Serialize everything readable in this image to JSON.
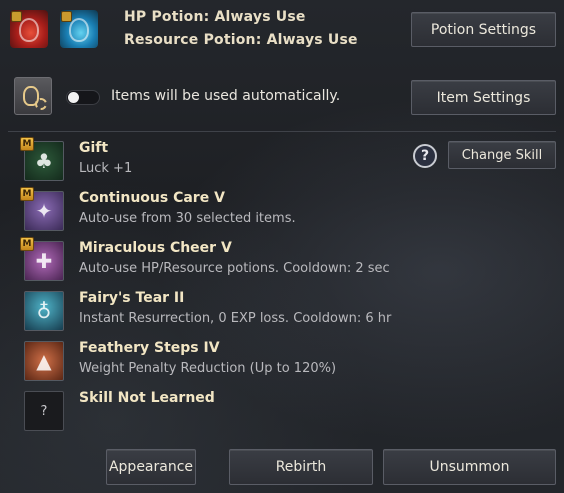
{
  "potions": {
    "hp_line": "HP Potion: Always Use",
    "resource_line": "Resource Potion: Always Use",
    "settings_button": "Potion Settings"
  },
  "auto": {
    "toggle_on": false,
    "text": "Items will be used automatically.",
    "settings_button": "Item Settings"
  },
  "skills_header": {
    "help": "?",
    "change_button": "Change Skill"
  },
  "skills": [
    {
      "badge": "M",
      "name": "Gift",
      "desc": "Luck +1",
      "icon": "clover-icon"
    },
    {
      "badge": "M",
      "name": "Continuous Care V",
      "desc": "Auto-use from 30 selected items.",
      "icon": "fairy-icon"
    },
    {
      "badge": "M",
      "name": "Miraculous Cheer V",
      "desc": "Auto-use HP/Resource potions. Cooldown: 2 sec",
      "icon": "potion-plus-icon"
    },
    {
      "badge": "",
      "name": "Fairy's Tear II",
      "desc": "Instant Resurrection, 0 EXP loss. Cooldown: 6 hr",
      "icon": "winged-flask-icon"
    },
    {
      "badge": "",
      "name": "Feathery Steps IV",
      "desc": "Weight Penalty Reduction (Up to 120%)",
      "icon": "weight-icon"
    },
    {
      "badge": "",
      "name": "Skill Not Learned",
      "desc": "",
      "icon": "unknown-icon",
      "glyph": "?"
    }
  ],
  "footer": {
    "appearance": "Appearance",
    "rebirth": "Rebirth",
    "unsummon": "Unsummon"
  },
  "colors": {
    "accent_gold": "#f3c34a",
    "skill_name": "#f2e6c4",
    "desc": "#b9b9bd"
  }
}
